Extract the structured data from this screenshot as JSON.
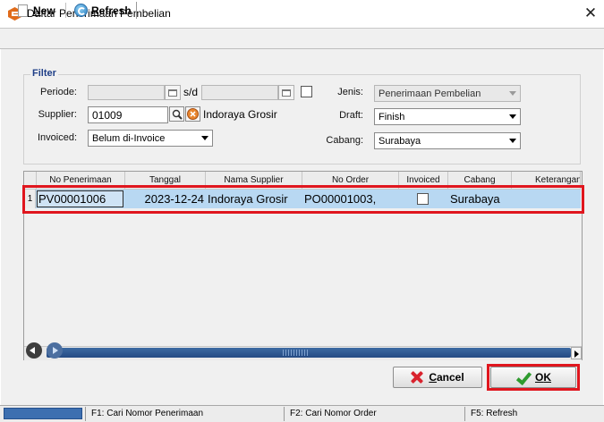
{
  "window": {
    "title": "Daftar Penerimaan Pembelian",
    "close_glyph": "✕"
  },
  "toolbar": {
    "new": {
      "underlined": "N",
      "rest": "ew"
    },
    "refresh": {
      "underlined": "R",
      "rest": "efresh"
    }
  },
  "filter": {
    "legend": "Filter",
    "periode": {
      "label": "Periode:",
      "start": "",
      "end": "",
      "separator": "s/d",
      "checked": false
    },
    "supplier": {
      "label": "Supplier:",
      "code": "01009",
      "name": "Indoraya Grosir"
    },
    "invoiced": {
      "label": "Invoiced:",
      "value": "Belum di-Invoice"
    },
    "jenis": {
      "label": "Jenis:",
      "value": "Penerimaan Pembelian"
    },
    "draft": {
      "label": "Draft:",
      "value": "Finish"
    },
    "cabang": {
      "label": "Cabang:",
      "value": "Surabaya"
    }
  },
  "grid": {
    "columns": [
      "No Penerimaan",
      "Tanggal",
      "Nama Supplier",
      "No Order",
      "Invoiced",
      "Cabang",
      "Keterangan"
    ],
    "rows": [
      {
        "num": "1",
        "no_penerimaan": "PV00001006",
        "tanggal": "2023-12-24",
        "nama_supplier": "Indoraya Grosir",
        "no_order": "PO00001003,",
        "invoiced": false,
        "cabang": "Surabaya",
        "keterangan": ""
      }
    ]
  },
  "buttons": {
    "cancel": {
      "underlined": "C",
      "rest": "ancel"
    },
    "ok": {
      "underlined": "O",
      "rest": "K"
    }
  },
  "statusbar": {
    "items": [
      "F1: Cari Nomor Penerimaan",
      "F2: Cari Nomor Order",
      "F5: Refresh"
    ]
  },
  "colors": {
    "highlight": "#e0161e",
    "selected_row": "#b8d8f2",
    "legend": "#1f3f88"
  }
}
